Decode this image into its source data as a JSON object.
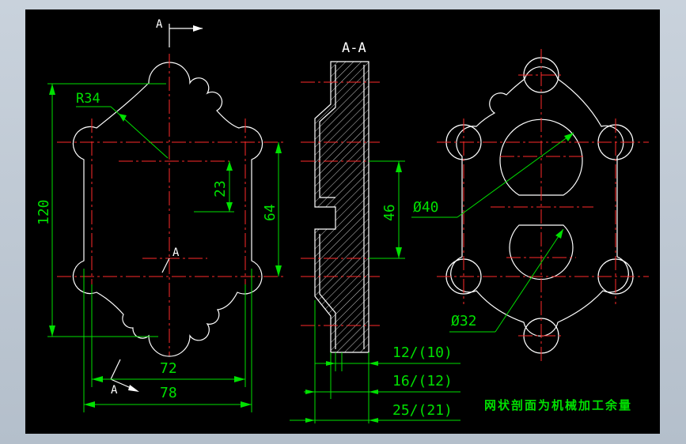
{
  "drawing": {
    "section_marker": "A",
    "section_title": "A-A",
    "dims": {
      "r34": "R34",
      "d120": "120",
      "d23": "23",
      "d64": "64",
      "d46": "46",
      "d72": "72",
      "d78": "78",
      "phi40": "Ø40",
      "phi32": "Ø32",
      "t1": "12/(10)",
      "t2": "16/(12)",
      "t3": "25/(21)"
    },
    "note": "网状剖面为机械加工余量"
  },
  "colors": {
    "outline": "#ffffff",
    "centerline": "#ff2a2a",
    "dimension": "#00e000",
    "background": "#000000"
  }
}
